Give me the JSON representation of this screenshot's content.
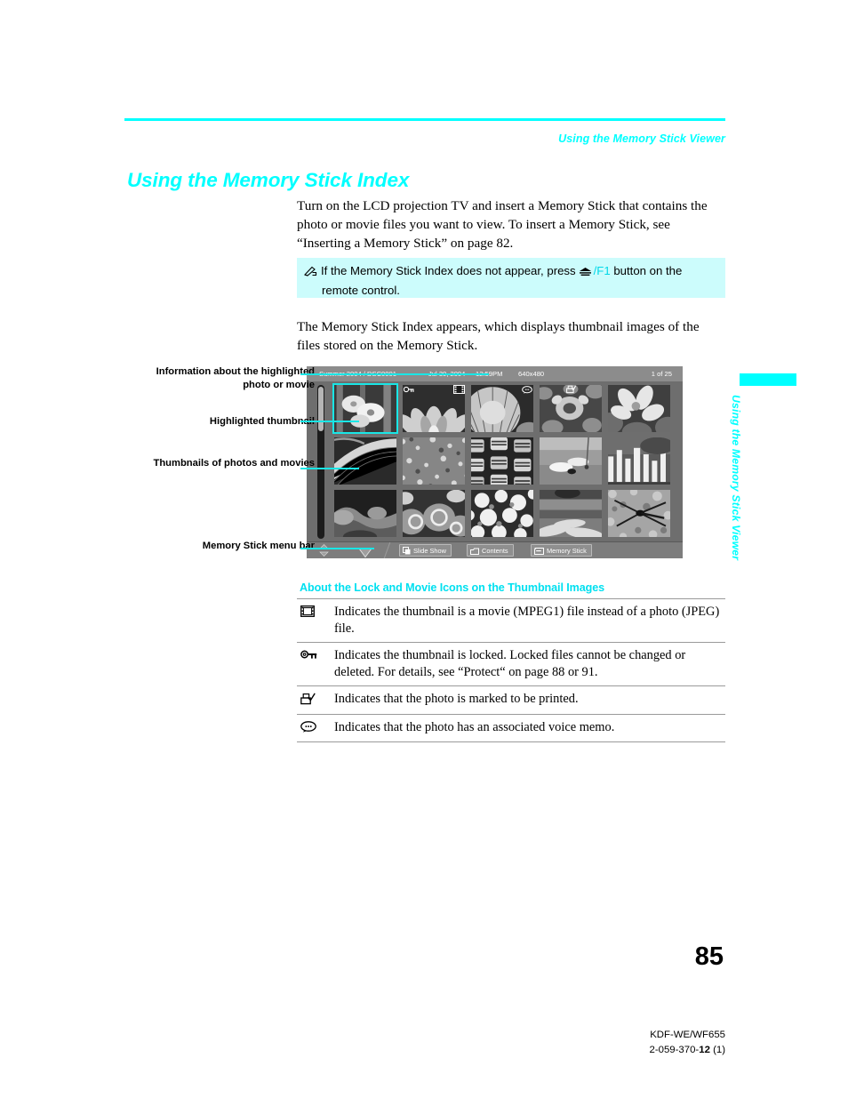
{
  "header": {
    "running_head": "Using the Memory Stick Viewer",
    "rule_color": "#00ffff"
  },
  "title": "Using the Memory Stick Index",
  "paragraphs": {
    "intro": "Turn on the LCD projection TV and insert a Memory Stick that contains the photo or movie files you want to view. To insert a Memory Stick, see “Inserting a Memory Stick” on page 82.",
    "result": "The Memory Stick Index appears, which displays thumbnail images of the files stored on the Memory Stick."
  },
  "note": {
    "icon": "note-pen-icon",
    "text_before": "If the Memory Stick Index does not appear, press",
    "jump_icon": "jump-button-icon",
    "f1_label": "/F1",
    "text_after": "button on the",
    "line2": "remote control.",
    "background": "#ccfcfc"
  },
  "screen": {
    "infobar": {
      "file_name": "Summer 2004  /  DSC0001",
      "date": "Jul 30, 2004",
      "time": "12:59PM",
      "resolution": "640x480",
      "count": "1 of 25"
    },
    "grid": {
      "columns": 5,
      "rows": 3,
      "selected_index": 0,
      "badges": [
        {
          "index": 1,
          "type": "lock-icon"
        },
        {
          "index": 1,
          "type": "movie-icon"
        },
        {
          "index": 3,
          "type": "voice-memo-icon"
        },
        {
          "index": 3,
          "type": "print-mark-icon"
        }
      ]
    },
    "menubar": {
      "nav_icons": [
        "up-down-arrow-icon",
        "down-triangle-icon"
      ],
      "buttons": [
        {
          "label": "Slide Show",
          "icon": "slide-show-icon"
        },
        {
          "label": "Contents",
          "icon": "contents-folder-icon"
        },
        {
          "label": "Memory Stick",
          "icon": "memory-stick-icon"
        }
      ]
    }
  },
  "callouts": [
    "Information about the highlighted photo or movie",
    "Highlighted thumbnail",
    "Thumbnails of photos and movies",
    "Memory Stick menu bar"
  ],
  "subsection": {
    "heading": "About the Lock and Movie Icons on the Thumbnail Images",
    "rows": [
      {
        "icon": "film-strip-icon",
        "text": "Indicates the thumbnail is a movie (MPEG1) file instead of a photo (JPEG) file."
      },
      {
        "icon": "key-lock-icon",
        "text": "Indicates the thumbnail is locked. Locked files cannot be changed or deleted. For details, see “Protect“ on page 88 or 91."
      },
      {
        "icon": "print-mark-icon",
        "text": "Indicates that the photo is marked to be printed."
      },
      {
        "icon": "voice-memo-icon",
        "text": "Indicates that the photo has an associated voice memo."
      }
    ]
  },
  "edge_tab": {
    "label": "Using the Memory Stick Viewer",
    "color": "#00ffff"
  },
  "footer": {
    "page_number": "85",
    "model": "KDF-WE/WF655",
    "doc_number_prefix": "2-059-370-",
    "doc_number_bold": "12",
    "doc_number_suffix": " (1)"
  }
}
